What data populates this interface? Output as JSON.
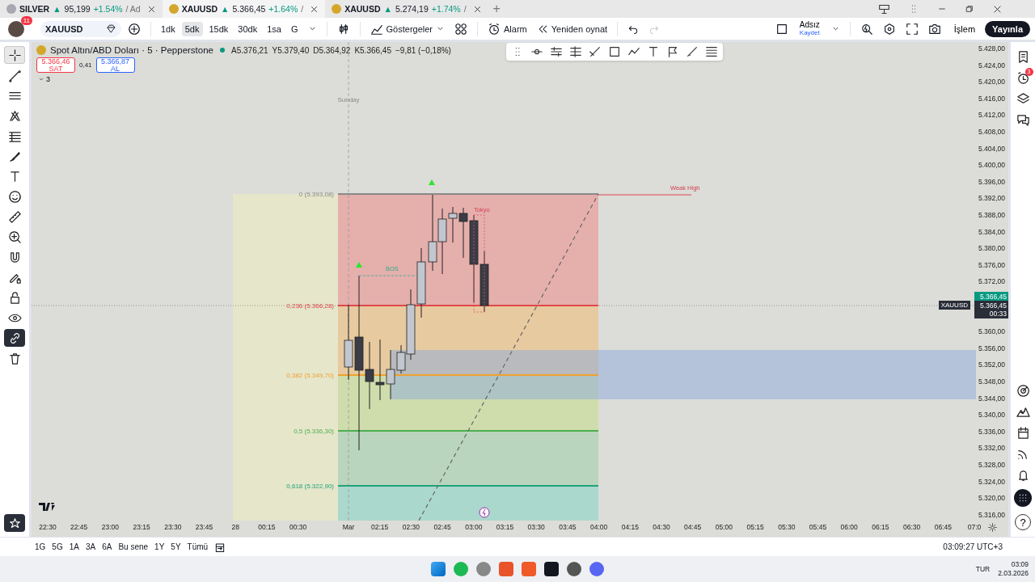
{
  "tabs": [
    {
      "symbol": "SILVER",
      "arrow": "▲",
      "price": "95,199",
      "change": "+1.54%",
      "suffix": "/ Ad",
      "color": "#a8a8b0",
      "selected": false
    },
    {
      "symbol": "XAUUSD",
      "arrow": "▲",
      "price": "5.366,45",
      "change": "+1.64%",
      "suffix": "/",
      "color": "#d4a72c",
      "selected": true
    },
    {
      "symbol": "XAUUSD",
      "arrow": "▲",
      "price": "5.274,19",
      "change": "+1.74%",
      "suffix": "/",
      "color": "#d4a72c",
      "selected": false
    }
  ],
  "new_tab": "+",
  "toolbar": {
    "notifications": "11",
    "symbol": "XAUUSD",
    "intervals": [
      {
        "label": "1dk",
        "selected": false
      },
      {
        "label": "5dk",
        "selected": true
      },
      {
        "label": "15dk",
        "selected": false
      },
      {
        "label": "30dk",
        "selected": false
      },
      {
        "label": "1sa",
        "selected": false
      },
      {
        "label": "G",
        "selected": false
      }
    ],
    "indicators": "Göstergeler",
    "alarm": "Alarm",
    "replay": "Yeniden oynat",
    "redo_disabled": true,
    "layout_name": "Adsız",
    "layout_save": "Kaydet",
    "trade": "İşlem",
    "publish": "Yayınla"
  },
  "left_tools": [
    {
      "kind": "crosshair",
      "selected": true,
      "on": false
    },
    {
      "kind": "trend-line",
      "selected": false,
      "on": false
    },
    {
      "kind": "parallel-lines",
      "selected": false,
      "on": false
    },
    {
      "kind": "pitchfork",
      "selected": false,
      "on": false
    },
    {
      "kind": "fib",
      "selected": false,
      "on": false
    },
    {
      "kind": "brush",
      "selected": false,
      "on": false
    },
    {
      "kind": "text",
      "selected": false,
      "on": false
    },
    {
      "kind": "smiley",
      "selected": false,
      "on": false
    },
    {
      "kind": "ruler",
      "selected": false,
      "on": false
    },
    {
      "kind": "zoom",
      "selected": false,
      "on": false
    },
    {
      "kind": "magnet",
      "selected": false,
      "on": false
    },
    {
      "kind": "pencil-lock",
      "selected": false,
      "on": false
    },
    {
      "kind": "lock",
      "selected": false,
      "on": false
    },
    {
      "kind": "eye",
      "selected": false,
      "on": false
    },
    {
      "kind": "link",
      "selected": false,
      "on": true
    },
    {
      "kind": "trash",
      "selected": false,
      "on": false
    }
  ],
  "legend": {
    "title": "Spot Altın/ABD Doları · 5 · Pepperstone",
    "ohlc": [
      {
        "label": "A",
        "value": "5.376,21"
      },
      {
        "label": "Y",
        "value": "5.379,40"
      },
      {
        "label": "D",
        "value": "5.364,92"
      },
      {
        "label": "K",
        "value": "5.366,45"
      }
    ],
    "change": "−9,81 (−0,18%)",
    "sell": {
      "price": "5.366,46",
      "label": "SAT"
    },
    "spread": "0,41",
    "buy": {
      "price": "5.366,87",
      "label": "AL"
    },
    "indicators_count": "3"
  },
  "chart": {
    "fib_levels": [
      {
        "label": "0 (5.393,08)",
        "color": "#8a8a8a"
      },
      {
        "label": "0,236 (5.366,28)",
        "color": "#e0474c"
      },
      {
        "label": "0,382 (5.349,70)",
        "color": "#f0a030"
      },
      {
        "label": "0,5 (5.336,30)",
        "color": "#4caf50"
      },
      {
        "label": "0,618 (5.322,90)",
        "color": "#1fa37a"
      }
    ],
    "annotations": [
      {
        "kind": "session",
        "text": "Sunday"
      },
      {
        "kind": "bos",
        "text": "BOS"
      },
      {
        "kind": "session-box",
        "text": "Tokyo"
      },
      {
        "kind": "weak-high",
        "text": "Weak High"
      }
    ]
  },
  "price_axis": {
    "ticks": [
      "5.428,00",
      "5.424,00",
      "5.420,00",
      "5.416,00",
      "5.412,00",
      "5.408,00",
      "5.404,00",
      "5.400,00",
      "5.396,00",
      "5.392,00",
      "5.388,00",
      "5.384,00",
      "5.380,00",
      "5.376,00",
      "5.372,00",
      "5.360,00",
      "5.356,00",
      "5.352,00",
      "5.348,00",
      "5.344,00",
      "5.340,00",
      "5.336,00",
      "5.332,00",
      "5.328,00",
      "5.324,00",
      "5.320,00",
      "5.316,00"
    ],
    "last_price": "5.366,45",
    "symbol_tag": "XAUUSD",
    "bar_price": "5.366,45",
    "countdown": "00:33"
  },
  "time_axis": [
    "22:30",
    "22:45",
    "23:00",
    "23:15",
    "23:30",
    "23:45",
    "28",
    "00:15",
    "00:30",
    "Mar",
    "02:15",
    "02:30",
    "02:45",
    "03:00",
    "03:15",
    "03:30",
    "03:45",
    "04:00",
    "04:15",
    "04:30",
    "04:45",
    "05:00",
    "05:15",
    "05:30",
    "05:45",
    "06:00",
    "06:15",
    "06:30",
    "06:45",
    "07:0"
  ],
  "right_sidebar": {
    "alarm_count": "3",
    "help": "?"
  },
  "bottom_bar": {
    "ranges": [
      "1G",
      "5G",
      "1A",
      "3A",
      "6A",
      "Bu sene",
      "1Y",
      "5Y",
      "Tümü"
    ],
    "clock": "03:09:27 UTC+3"
  },
  "taskbar": {
    "language": "TUR",
    "time": "03:09",
    "date": "2.03.2026"
  }
}
